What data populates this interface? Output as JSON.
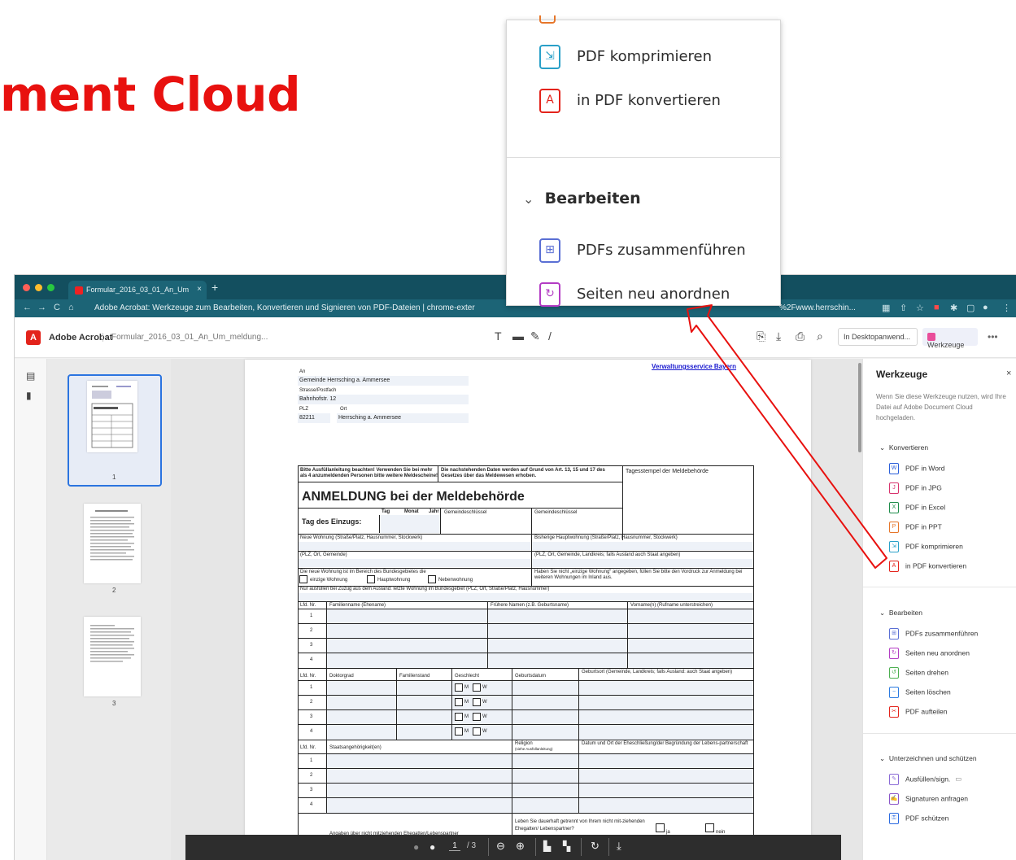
{
  "background_heading": "ment Cloud",
  "browser": {
    "tab_title": "Formular_2016_03_01_An_Um",
    "tab_close": "×",
    "new_tab": "+",
    "url": "Adobe Acrobat: Werkzeuge zum Bearbeiten, Konvertieren und Signieren von PDF-Dateien | chrome-exter",
    "url_tail": "%2Fwww.herrschin...",
    "nav_back": "←",
    "nav_forward": "→",
    "nav_reload": "C",
    "nav_home": "⌂"
  },
  "app": {
    "title": "Adobe Acrobat",
    "document_name": "Formular_2016_03_01_An_Um_meldung...",
    "desktop_button": "In Desktopanwend...",
    "tools_button": "Werkzeuge",
    "more": "•••"
  },
  "thumbnails": [
    {
      "number": "1"
    },
    {
      "number": "2"
    },
    {
      "number": "3"
    }
  ],
  "form": {
    "an": "An",
    "gemeinde": "Gemeinde Herrsching a. Ammersee",
    "strasse_label": "Strasse/Postfach",
    "strasse": "Bahnhofstr. 12",
    "plz_label": "PLZ",
    "ort_label": "Ort",
    "plz": "82211",
    "ort": "Herrsching a. Ammersee",
    "link": "Verwaltungsservice Bayern",
    "hint1": "Bitte Ausfüllanleitung beachten! Verwenden Sie bei mehr als 4 anzumeldenden Personen bitte weitere Meldescheine!",
    "hint2": "Die nachstehenden Daten werden auf Grund von Art. 13, 15 und 17 des Gesetzes über das Meldewesen erhoben.",
    "stamp": "Tagesstempel der Meldebehörde",
    "title": "ANMELDUNG bei der Meldebehörde",
    "tag_einzugs": "Tag des Einzugs:",
    "tag": "Tag",
    "monat": "Monat",
    "jahr": "Jahr",
    "gemeindeschluessel": "Gemeindeschlüssel",
    "neue_wohnung": "Neue Wohnung (Straße/Platz, Hausnummer, Stockwerk)",
    "bisherige": "Bisherige Hauptwohnung (Straße/Platz, Hausnummer, Stockwerk)",
    "plz_ort_gemeinde": "(PLZ, Ort, Gemeinde)",
    "plz_ort_landkreis": "(PLZ, Ort, Gemeinde, Landkreis; falls Ausland auch Staat angeben)",
    "bereich": "Die neue Wohnung ist im Bereich des Bundesgebietes die",
    "einzige": "einzige Wohnung",
    "haupt": "Hauptwohnung",
    "neben": "Nebenwohnung",
    "haben_sie": "Haben Sie nicht „einzige Wohnung“ angegeben, füllen Sie bitte den Vordruck zur Anmeldung bei weiteren Wohnungen im Inland aus.",
    "nur_ausfuellen": "Nur ausfüllen bei Zuzug aus dem Ausland: letzte Wohnung im Bundesgebiet (PLZ, Ort, Straße/Platz, Hausnummer)",
    "lfd_nr": "Lfd. Nr.",
    "familienname": "Familienname (Ehename)",
    "fruehere_namen": "Frühere Namen (z.B. Geburtsname)",
    "vornamen": "Vorname(n) (Rufname unterstreichen)",
    "doktorgrad": "Doktorgrad",
    "familienstand": "Familienstand",
    "geschlecht": "Geschlecht",
    "geburtsdatum": "Geburtsdatum",
    "geburtsort": "Geburtsort (Gemeinde, Landkreis; falls Ausland: auch Staat angeben)",
    "m": "M",
    "w": "W",
    "staatsangehoerigkeit": "Staatsangehörigkeit(en)",
    "religion": "Religion",
    "religion_sub": "(siehe Ausfüllanleitung)",
    "eheschliessung": "Datum und Ort der Eheschließung/der Begründung der Lebens-partnerschaft",
    "rows": [
      "1",
      "2",
      "3",
      "4"
    ],
    "angaben": "Angaben über nicht mitziehenden Ehegatten/Lebenspartner",
    "leben_sie": "Leben Sie dauerhaft getrennt von Ihrem nicht mit-ziehenden Ehegatten/ Lebenspartner?",
    "ja": "ja",
    "nein": "nein"
  },
  "bottombar": {
    "page_current": "1",
    "page_total": "/ 3"
  },
  "right_panel": {
    "title": "Werkzeuge",
    "close": "×",
    "description": "Wenn Sie diese Werkzeuge nutzen, wird Ihre Datei auf Adobe Document Cloud hochgeladen.",
    "sections": [
      {
        "label": "Konvertieren",
        "items": [
          {
            "label": "PDF in Word",
            "color": "#2b5fd9"
          },
          {
            "label": "PDF in JPG",
            "color": "#d8336d"
          },
          {
            "label": "PDF in Excel",
            "color": "#1e8c4a"
          },
          {
            "label": "PDF in PPT",
            "color": "#e6762a"
          },
          {
            "label": "PDF komprimieren",
            "color": "#2aa0c8"
          },
          {
            "label": "in PDF konvertieren",
            "color": "#e3231b"
          }
        ]
      },
      {
        "label": "Bearbeiten",
        "items": [
          {
            "label": "PDFs zusammenführen",
            "color": "#5a6fd4"
          },
          {
            "label": "Seiten neu anordnen",
            "color": "#b33cc4"
          },
          {
            "label": "Seiten drehen",
            "color": "#4caf50"
          },
          {
            "label": "Seiten löschen",
            "color": "#2b7ae0"
          },
          {
            "label": "PDF aufteilen",
            "color": "#e3231b"
          }
        ]
      },
      {
        "label": "Unterzeichnen und schützen",
        "items": [
          {
            "label": "Ausfüllen/sign.",
            "color": "#8a6ad6"
          },
          {
            "label": "Signaturen anfragen",
            "color": "#8a55c8"
          },
          {
            "label": "PDF schützen",
            "color": "#2b6ae0"
          }
        ]
      }
    ]
  },
  "popup": {
    "items_top": [
      {
        "label": "PDF komprimieren",
        "color": "#2aa0c8"
      },
      {
        "label": "in PDF konvertieren",
        "color": "#e3231b"
      }
    ],
    "section": "Bearbeiten",
    "items_bottom": [
      {
        "label": "PDFs zusammenführen",
        "color": "#5a6fd4"
      },
      {
        "label": "Seiten neu anordnen",
        "color": "#b33cc4"
      }
    ]
  },
  "colors": {
    "accent_red": "#e8110f",
    "browser_teal": "#134f5f",
    "selection_blue": "#2b74e0",
    "annotation_arrow": "#e8110f"
  }
}
